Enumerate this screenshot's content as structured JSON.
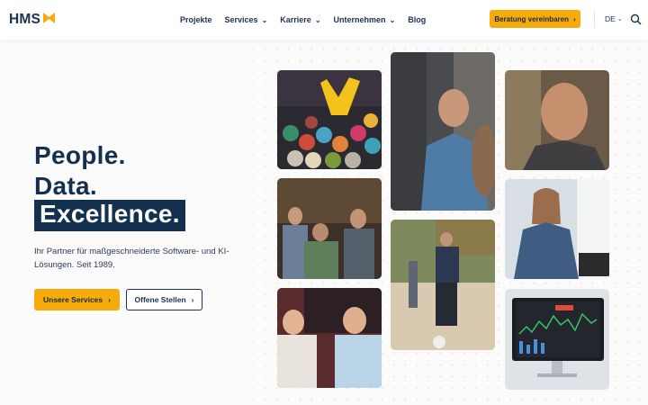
{
  "brand": {
    "name": "HMS",
    "accent": "#f6ab0a",
    "navy": "#14304f"
  },
  "nav": {
    "items": [
      {
        "label": "Projekte",
        "dropdown": false
      },
      {
        "label": "Services",
        "dropdown": true
      },
      {
        "label": "Karriere",
        "dropdown": true
      },
      {
        "label": "Unternehmen",
        "dropdown": true
      },
      {
        "label": "Blog",
        "dropdown": false
      }
    ],
    "cta_label": "Beratung vereinbaren",
    "language": "DE"
  },
  "hero": {
    "line1": "People.",
    "line2": "Data.",
    "line3": "Excellence.",
    "subtitle": "Ihr Partner für maßgeschneiderte Software- und KI-Lösungen. Seit 1989.",
    "primary_button": "Unsere Services",
    "secondary_button": "Offene Stellen"
  },
  "icons": {
    "logo": "hms-logo-icon",
    "chevron": "chevron-down-icon",
    "arrow": "chevron-right-icon",
    "search": "search-icon"
  }
}
